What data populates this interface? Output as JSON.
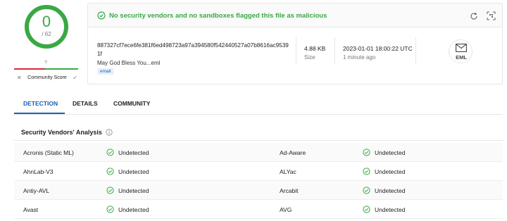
{
  "score": {
    "detections": "0",
    "total": "/ 62",
    "ring_color": "#3aa845"
  },
  "community": {
    "question_mark": "?",
    "label": "Community Score",
    "x_icon": "✕",
    "check_icon": "✓"
  },
  "banner": {
    "text": "No security vendors and no sandboxes flagged this file as malicious",
    "status_color": "#3aa845"
  },
  "file": {
    "hash": "887327cf7ece6fe381f6ed498723a97a394580f542440527a07b8616ac95391f",
    "name": "May God Bless You...eml",
    "tag": "email",
    "size": "4.88 KB",
    "size_label": "Size",
    "date": "2023-01-01 18:00:22 UTC",
    "date_ago": "1 minute ago",
    "type_icon_label": "EML"
  },
  "tabs": [
    {
      "label": "DETECTION",
      "active": true
    },
    {
      "label": "DETAILS",
      "active": false
    },
    {
      "label": "COMMUNITY",
      "active": false
    }
  ],
  "analysis": {
    "title": "Security Vendors' Analysis",
    "rows": [
      {
        "left_vendor": "Acronis (Static ML)",
        "left_status": "Undetected",
        "right_vendor": "Ad-Aware",
        "right_status": "Undetected"
      },
      {
        "left_vendor": "AhnLab-V3",
        "left_status": "Undetected",
        "right_vendor": "ALYac",
        "right_status": "Undetected"
      },
      {
        "left_vendor": "Antiy-AVL",
        "left_status": "Undetected",
        "right_vendor": "Arcabit",
        "right_status": "Undetected"
      },
      {
        "left_vendor": "Avast",
        "left_status": "Undetected",
        "right_vendor": "AVG",
        "right_status": "Undetected"
      }
    ]
  },
  "colors": {
    "accent": "#1a5fb4",
    "clean": "#3aa845",
    "malicious": "#d7263d"
  }
}
